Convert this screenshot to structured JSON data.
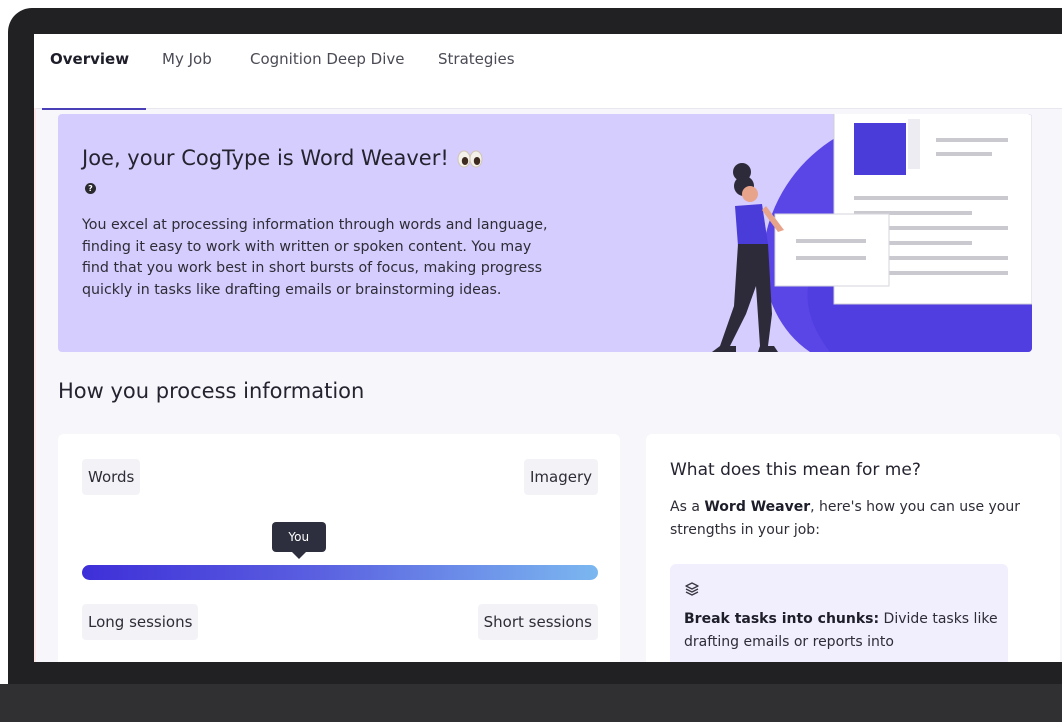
{
  "tabs": [
    {
      "label": "Overview",
      "active": true
    },
    {
      "label": "My Job",
      "active": false
    },
    {
      "label": "Cognition Deep Dive",
      "active": false
    },
    {
      "label": "Strategies",
      "active": false
    }
  ],
  "hero": {
    "title": "Joe, your CogType is Word Weaver!",
    "title_icon": "eyes-emoji",
    "help_icon": "question-circle-icon",
    "description": "You excel at processing information through words and language, finding it easy to work with written or spoken content. You may find that you work best in short bursts of focus, making progress quickly in tasks like drafting emails or brainstorming ideas."
  },
  "section": {
    "title": "How you process information"
  },
  "spectrum": {
    "left_label": "Words",
    "right_label": "Imagery",
    "marker_label": "You",
    "marker_position": 0.42,
    "bottom_left_label": "Long sessions",
    "bottom_right_label": "Short sessions"
  },
  "meaning": {
    "title": "What does this mean for me?",
    "intro_prefix": "As a ",
    "intro_strong": "Word Weaver",
    "intro_suffix": ", here's how you can use your strengths in your job:",
    "strategy_icon": "layers-icon",
    "strategy_strong": "Break tasks into chunks:",
    "strategy_text": " Divide tasks like drafting emails or reports into"
  },
  "colors": {
    "accent": "#4a3fb7",
    "hero_bg": "#d5cdfd",
    "bar_start": "#3e2fd8",
    "bar_end": "#7bb7f0",
    "frame": "#212123"
  }
}
